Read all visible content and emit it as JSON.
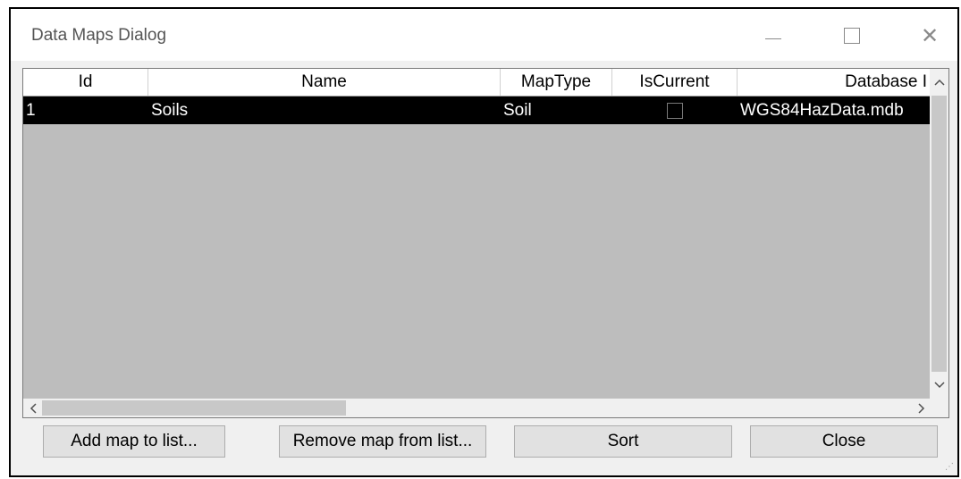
{
  "window": {
    "title": "Data Maps Dialog"
  },
  "grid": {
    "columns": [
      "Id",
      "Name",
      "MapType",
      "IsCurrent",
      "Database I"
    ],
    "rows": [
      {
        "id": "1",
        "name": "Soils",
        "map_type": "Soil",
        "is_current": false,
        "database": "WGS84HazData.mdb"
      }
    ],
    "selected_row": 0
  },
  "buttons": {
    "add": "Add map to list...",
    "remove": "Remove map from list...",
    "sort": "Sort",
    "close": "Close"
  },
  "icons": {
    "scroll_up": "▲",
    "scroll_down": "▼",
    "scroll_left": "‹",
    "scroll_right": "›"
  },
  "colors": {
    "selected_row_bg": "#000000",
    "selected_row_text": "#ffffff",
    "grid_empty_bg": "#bdbdbd"
  }
}
